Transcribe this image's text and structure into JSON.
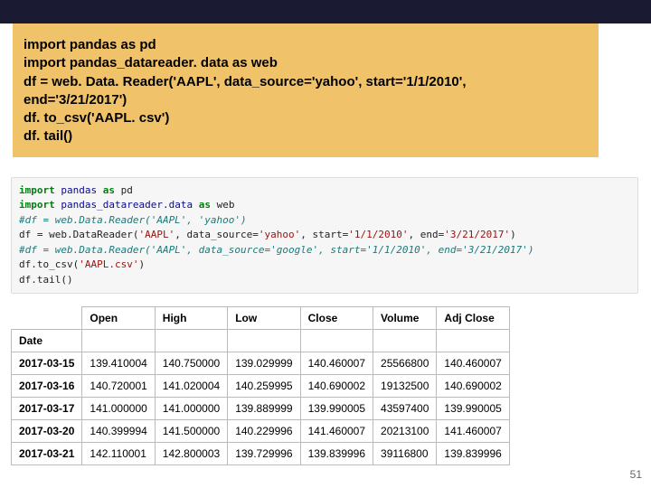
{
  "slide": {
    "code_lines": [
      "import pandas as pd",
      "import pandas_datareader. data as web",
      "df = web. Data. Reader('AAPL', data_source='yahoo', start='1/1/2010',",
      "end='3/21/2017')",
      "df. to_csv('AAPL. csv')",
      "df. tail()"
    ]
  },
  "cell": {
    "l1_a": "import",
    "l1_b": " pandas ",
    "l1_c": "as",
    "l1_d": " pd",
    "l2_a": "import",
    "l2_b": " pandas_datareader.data ",
    "l2_c": "as",
    "l2_d": " web",
    "l3": "#df = web.Data.Reader('AAPL', 'yahoo')",
    "l4_a": "df = web.DataReader(",
    "l4_s1": "'AAPL'",
    "l4_b": ", data_source=",
    "l4_s2": "'yahoo'",
    "l4_c": ", start=",
    "l4_s3": "'1/1/2010'",
    "l4_d": ", end=",
    "l4_s4": "'3/21/2017'",
    "l4_e": ")",
    "l5": "#df = web.Data.Reader('AAPL', data_source='google', start='1/1/2010', end='3/21/2017')",
    "l6_a": "df.to_csv(",
    "l6_s": "'AAPL.csv'",
    "l6_b": ")",
    "l7": "df.tail()"
  },
  "chart_data": {
    "type": "table",
    "index_name": "Date",
    "columns": [
      "Open",
      "High",
      "Low",
      "Close",
      "Volume",
      "Adj Close"
    ],
    "rows": [
      {
        "date": "2017-03-15",
        "cells": [
          "139.410004",
          "140.750000",
          "139.029999",
          "140.460007",
          "25566800",
          "140.460007"
        ]
      },
      {
        "date": "2017-03-16",
        "cells": [
          "140.720001",
          "141.020004",
          "140.259995",
          "140.690002",
          "19132500",
          "140.690002"
        ]
      },
      {
        "date": "2017-03-17",
        "cells": [
          "141.000000",
          "141.000000",
          "139.889999",
          "139.990005",
          "43597400",
          "139.990005"
        ]
      },
      {
        "date": "2017-03-20",
        "cells": [
          "140.399994",
          "141.500000",
          "140.229996",
          "141.460007",
          "20213100",
          "141.460007"
        ]
      },
      {
        "date": "2017-03-21",
        "cells": [
          "142.110001",
          "142.800003",
          "139.729996",
          "139.839996",
          "39116800",
          "139.839996"
        ]
      }
    ]
  },
  "page_number": "51"
}
